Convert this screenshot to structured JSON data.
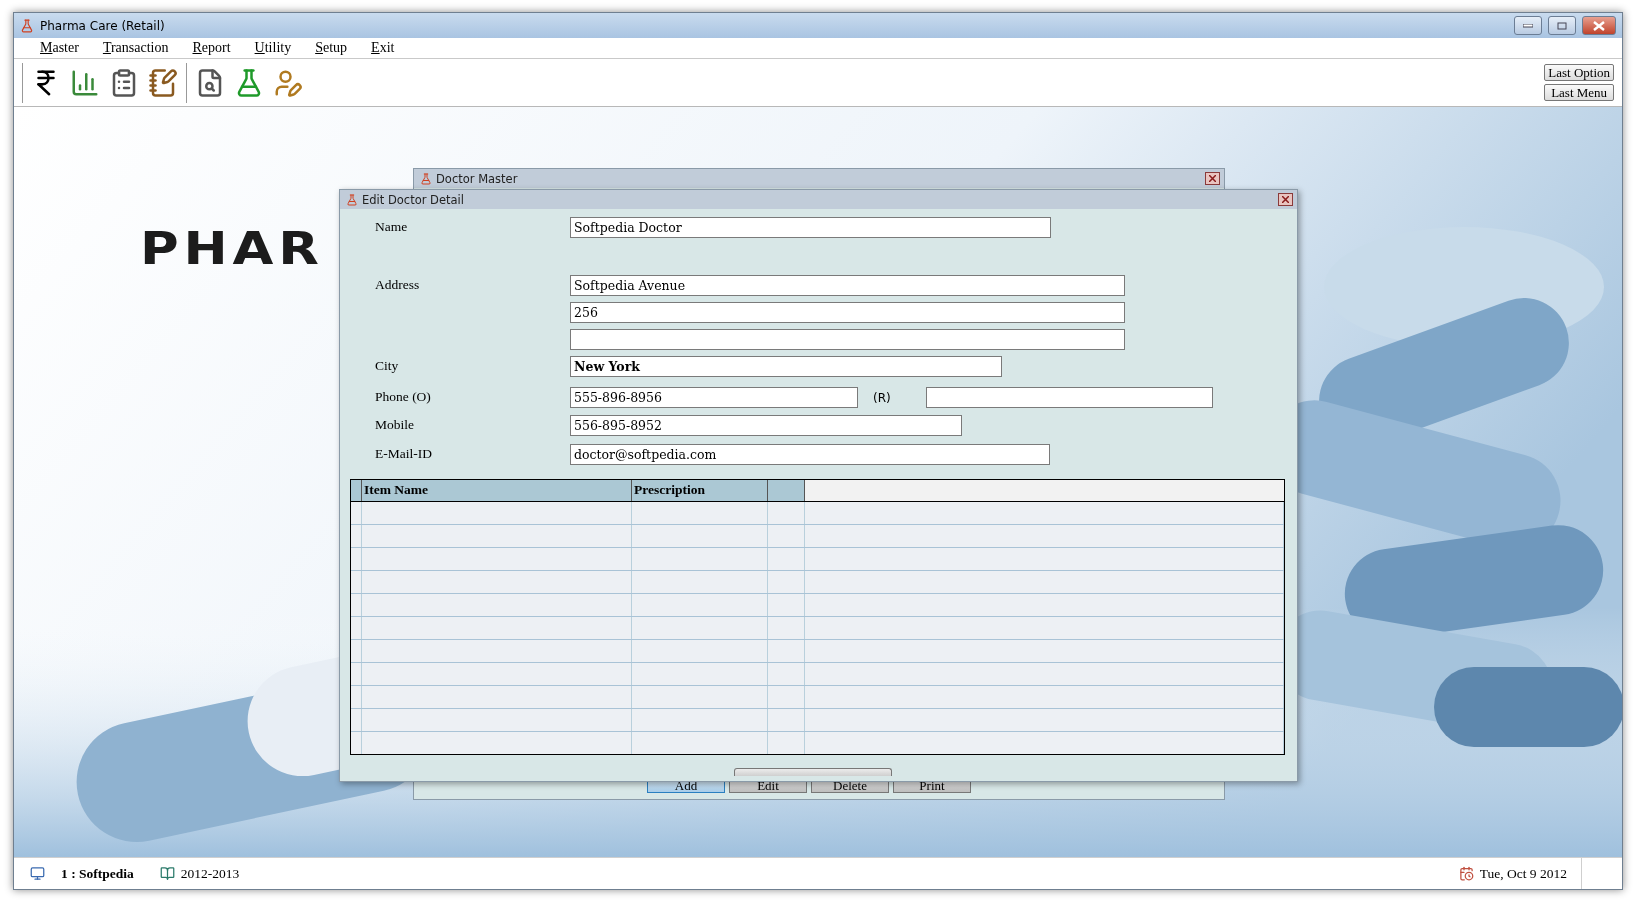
{
  "window": {
    "title": "Pharma Care (Retail)"
  },
  "menu": [
    {
      "label": "Master"
    },
    {
      "label": "Transaction"
    },
    {
      "label": "Report"
    },
    {
      "label": "Utility"
    },
    {
      "label": "Setup"
    },
    {
      "label": "Exit"
    }
  ],
  "toolbar": [
    {
      "kind": "rupee"
    },
    {
      "kind": "chart"
    },
    {
      "kind": "clipboard"
    },
    {
      "kind": "order"
    },
    {
      "kind": "separator"
    },
    {
      "kind": "search-doc"
    },
    {
      "kind": "flask"
    },
    {
      "kind": "person"
    }
  ],
  "side_buttons": [
    "Last Option",
    "Last Menu"
  ],
  "logo_text": "PHAR",
  "doctor_master": {
    "title": "Doctor Master",
    "buttons": [
      {
        "label": "Add",
        "default": true
      },
      {
        "label": "Edit",
        "default": false
      },
      {
        "label": "Delete",
        "default": false
      },
      {
        "label": "Print",
        "default": false
      }
    ]
  },
  "edit_dialog": {
    "title": "Edit Doctor Detail",
    "fields": [
      {
        "label": "Name",
        "inputs": [
          {
            "kind": "text",
            "value": "Softpedia Doctor",
            "bold": false
          }
        ]
      },
      {
        "label": "Address",
        "inputs": [
          {
            "kind": "text",
            "value": "Softpedia Avenue",
            "bold": false
          },
          {
            "kind": "text",
            "value": "256",
            "bold": false
          },
          {
            "kind": "empty"
          }
        ]
      },
      {
        "label": "City",
        "inputs": [
          {
            "kind": "text",
            "value": "New York",
            "bold": true
          }
        ]
      },
      {
        "label": "Phone (O)",
        "inputs": [
          {
            "kind": "text",
            "value": "555-896-8956",
            "bold": false
          },
          {
            "label": "(R)",
            "kind": "empty"
          }
        ]
      },
      {
        "label": "Mobile",
        "inputs": [
          {
            "kind": "text",
            "value": "556-895-8952",
            "bold": false
          }
        ]
      },
      {
        "label": "E-Mail-ID",
        "inputs": [
          {
            "kind": "text",
            "value": "doctor@softpedia.com",
            "bold": false
          }
        ]
      }
    ],
    "table": {
      "columns": [
        "Item Name",
        "Prescription"
      ]
    }
  },
  "status_bar": {
    "user": "1 : Softpedia",
    "year": "2012-2013",
    "date": "Tue, Oct 9 2012"
  }
}
